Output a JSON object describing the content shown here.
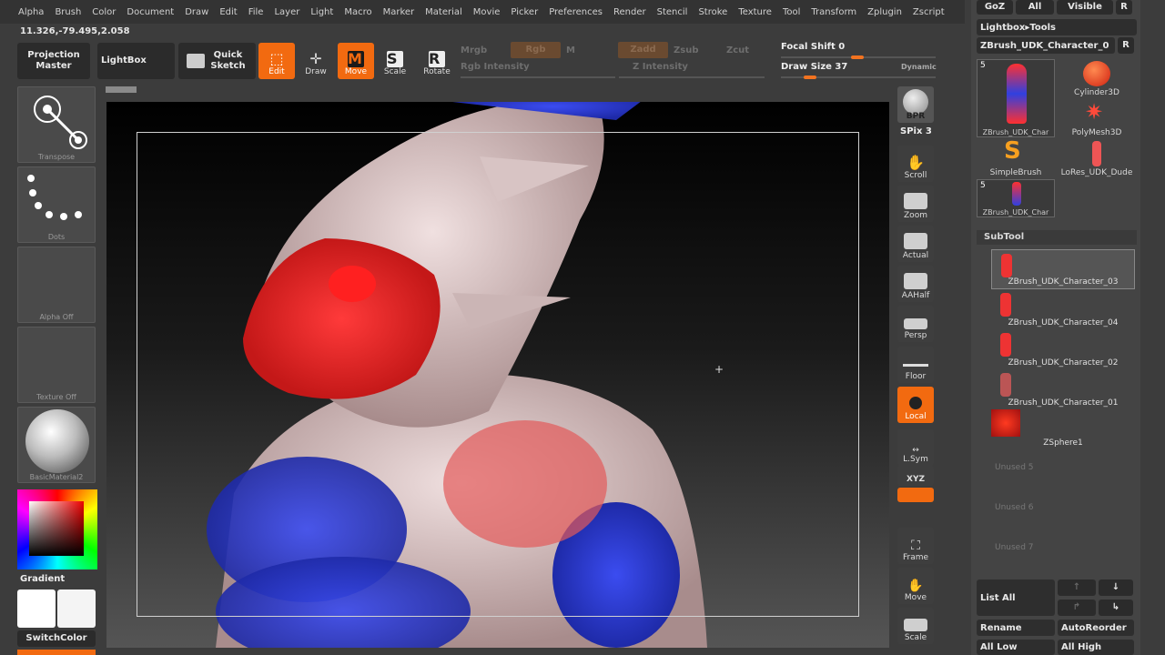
{
  "menu": [
    "Alpha",
    "Brush",
    "Color",
    "Document",
    "Draw",
    "Edit",
    "File",
    "Layer",
    "Light",
    "Macro",
    "Marker",
    "Material",
    "Movie",
    "Picker",
    "Preferences",
    "Render",
    "Stencil",
    "Stroke",
    "Texture",
    "Tool",
    "Transform",
    "Zplugin",
    "Zscript"
  ],
  "coords": "11.326,-79.495,2.058",
  "toolbar": {
    "projection_master": "Projection Master",
    "lightbox": "LightBox",
    "quick_sketch": "Quick Sketch",
    "edit": "Edit",
    "draw": "Draw",
    "move": "Move",
    "scale": "Scale",
    "rotate": "Rotate",
    "mrgb": "Mrgb",
    "rgb": "Rgb",
    "m": "M",
    "rgb_intensity": "Rgb  Intensity",
    "zadd": "Zadd",
    "zsub": "Zsub",
    "zcut": "Zcut",
    "z_intensity": "Z  Intensity",
    "focal_shift": "Focal Shift 0",
    "draw_size": "Draw Size 37",
    "dynamic": "Dynamic"
  },
  "left": {
    "transpose": "Transpose",
    "dots": "Dots",
    "alpha": "Alpha  Off",
    "texture": "Texture  Off",
    "material": "BasicMaterial2",
    "gradient": "Gradient",
    "switchcolor": "SwitchColor"
  },
  "right": {
    "bpr": "BPR",
    "spix": "SPix 3",
    "scroll": "Scroll",
    "zoom": "Zoom",
    "actual": "Actual",
    "aahalf": "AAHalf",
    "persp": "Persp",
    "floor": "Floor",
    "local": "Local",
    "lsym": "L.Sym",
    "xyz": "XYZ",
    "frame": "Frame",
    "move": "Move",
    "scale": "Scale"
  },
  "lightbox": {
    "goz": "GoZ",
    "all": "All",
    "visible": "Visible",
    "r": "R",
    "path": "Lightbox▸Tools",
    "current": "ZBrush_UDK_Character_0",
    "count1": "5",
    "count2": "5",
    "items": [
      "ZBrush_UDK_Char",
      "Cylinder3D",
      "PolyMesh3D",
      "SimpleBrush",
      "LoRes_UDK_Dude",
      "ZBrush_UDK_Char"
    ]
  },
  "subtool": {
    "title": "SubTool",
    "items": [
      "ZBrush_UDK_Character_03",
      "ZBrush_UDK_Character_04",
      "ZBrush_UDK_Character_02",
      "ZBrush_UDK_Character_01",
      "ZSphere1"
    ],
    "unused": [
      "Unused 5",
      "Unused 6",
      "Unused 7"
    ],
    "list_all": "List  All",
    "rename": "Rename",
    "autoreorder": "AutoReorder",
    "all_low": "All Low",
    "all_high": "All High"
  },
  "colors": {
    "accent": "#f26a10",
    "red": "#e02a2a",
    "blue": "#2e3ed8"
  }
}
